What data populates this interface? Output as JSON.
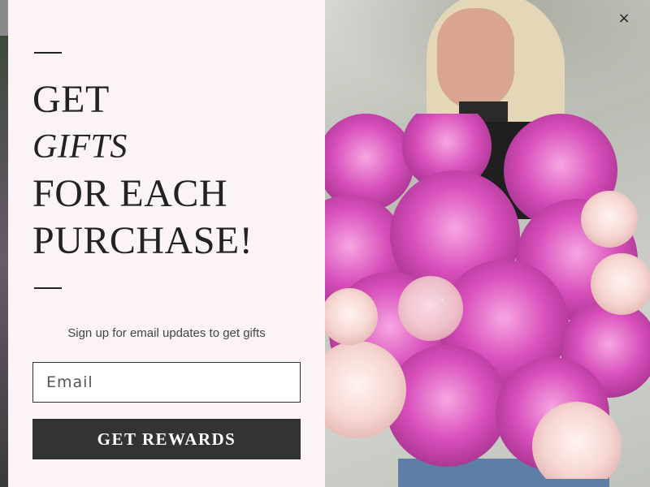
{
  "popup": {
    "headline": {
      "line1": "GET",
      "line2": "GIFTS",
      "line3": "FOR EACH",
      "line4": "PURCHASE!"
    },
    "subtext": "Sign up for email updates to get gifts",
    "email_placeholder": "Email",
    "email_value": "",
    "cta_label": "GET REWARDS",
    "close_label": "×"
  },
  "colors": {
    "panel_bg": "#fcf3f6",
    "text": "#222222",
    "button_bg": "#333333",
    "button_text": "#ffffff",
    "backdrop": "#4a4a4a"
  },
  "icons": {
    "close": "close-icon"
  }
}
